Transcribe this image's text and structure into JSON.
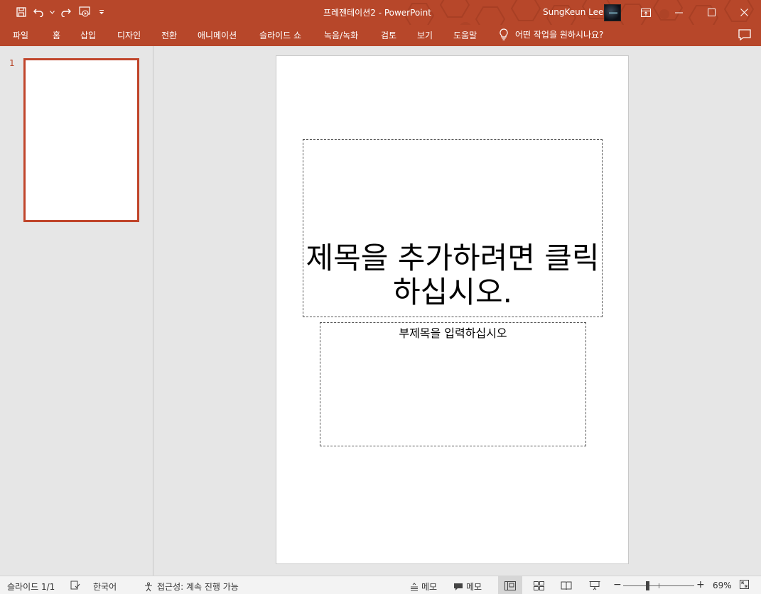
{
  "window": {
    "title": "프레젠테이션2  -  PowerPoint",
    "user_name": "SungKeun Lee",
    "brand_color": "#b7472a"
  },
  "qat": {
    "items": [
      "save-icon",
      "undo-icon",
      "redo-icon",
      "start-from-beginning-icon",
      "customize-qat-icon"
    ]
  },
  "ribbon": {
    "tabs": [
      "파일",
      "홈",
      "삽입",
      "디자인",
      "전환",
      "애니메이션",
      "슬라이드 쇼",
      "녹음/녹화",
      "검토",
      "보기",
      "도움말"
    ],
    "tell_me": "어떤 작업을 원하시나요?"
  },
  "thumbnails": {
    "items": [
      {
        "number": "1"
      }
    ]
  },
  "slide": {
    "title_placeholder": "제목을 추가하려면 클릭하십시오.",
    "subtitle_placeholder": "부제목을 입력하십시오"
  },
  "status": {
    "slide_count": "슬라이드 1/1",
    "language": "한국어",
    "accessibility": "접근성: 계속 진행 가능",
    "notes": "메모",
    "comments": "메모",
    "zoom_minus": "−",
    "zoom_plus": "+",
    "zoom_value": "69%",
    "zoom_level_percent": 69
  }
}
